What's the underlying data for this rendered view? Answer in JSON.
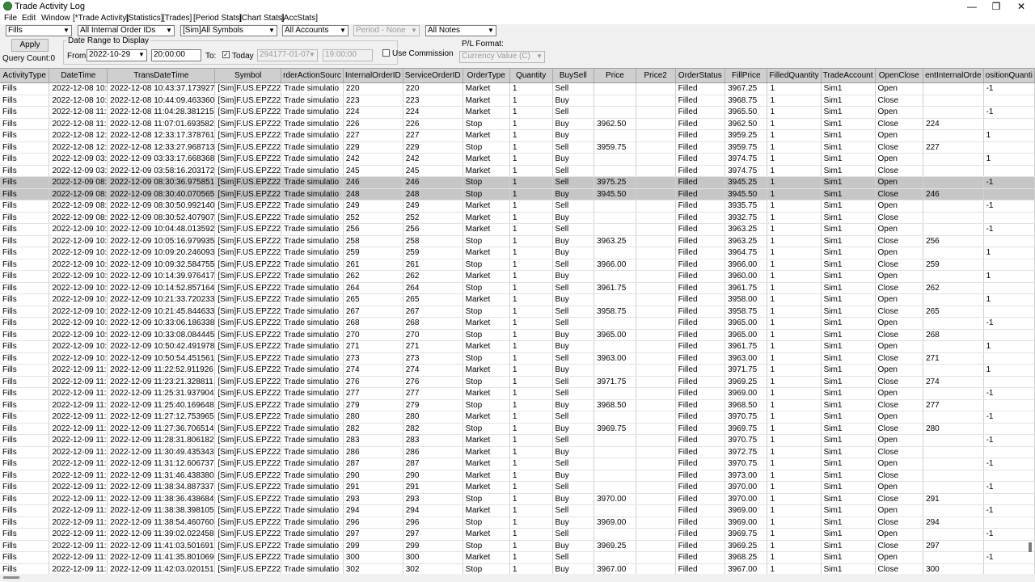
{
  "window": {
    "title": "Trade Activity Log",
    "minimize": "—",
    "maximize": "❐",
    "close": "✕",
    "accent": "#2e8b3a"
  },
  "menu": [
    "File",
    "Edit",
    "Window",
    "[*Trade Activity]",
    "[Statistics]",
    "[Trades]",
    "[Period Stats]",
    "[Chart Stats]",
    "[AccStats]"
  ],
  "toolbar": {
    "activity_filter": "Fills",
    "order_ids": "All Internal Order IDs",
    "symbols": "[Sim]All Symbols",
    "accounts": "All Accounts",
    "period": "Period - None",
    "notes": "All Notes",
    "apply": "Apply",
    "query_count": "Query Count:0",
    "date_range_label": "Date Range to Display",
    "from_label": "From:",
    "from_date": "2022-10-29",
    "from_time": "20:00:00",
    "to_label": "To:",
    "today_label": "Today",
    "to_date": "294177-01-07",
    "to_time": "19:00:00",
    "use_commission": "Use Commission",
    "pl_format_label": "P/L Format:",
    "pl_format": "Currency Value (C)",
    "check": "✓",
    "dropdown": "▼"
  },
  "table": {
    "columns": [
      "ActivityType",
      "DateTime",
      "TransDateTime",
      "Symbol",
      "OrderActionSource",
      "InternalOrderID",
      "ServiceOrderID",
      "OrderType",
      "Quantity",
      "BuySell",
      "Price",
      "Price2",
      "OrderStatus",
      "FillPrice",
      "FilledQuantity",
      "TradeAccount",
      "OpenClose",
      "ParentInternalOrderID",
      "PositionQuantity"
    ],
    "column_display": [
      "ActivityType",
      "DateTime",
      "TransDateTime",
      "Symbol",
      "rderActionSourc",
      "InternalOrderID",
      "ServiceOrderID",
      "OrderType",
      "Quantity",
      "BuySell",
      "Price",
      "Price2",
      "OrderStatus",
      "FillPrice",
      "FilledQuantity",
      "TradeAccount",
      "OpenClose",
      "entInternalOrde",
      "ositionQuanti"
    ],
    "rows": [
      [
        "Fills",
        "2022-12-08 10:",
        "2022-12-08 10:43:37.173927",
        "[Sim]F.US.EPZ22",
        "Trade simulatio",
        "220",
        "220",
        "Market",
        "1",
        "Sell",
        "",
        "",
        "Filled",
        "3967.25",
        "1",
        "Sim1",
        "Open",
        "",
        "-1"
      ],
      [
        "Fills",
        "2022-12-08 10:",
        "2022-12-08 10:44:09.463360",
        "[Sim]F.US.EPZ22",
        "Trade simulatio",
        "223",
        "223",
        "Market",
        "1",
        "Buy",
        "",
        "",
        "Filled",
        "3968.75",
        "1",
        "Sim1",
        "Close",
        "",
        ""
      ],
      [
        "Fills",
        "2022-12-08 11:",
        "2022-12-08 11:04:28.381215",
        "[Sim]F.US.EPZ22",
        "Trade simulatio",
        "224",
        "224",
        "Market",
        "1",
        "Sell",
        "",
        "",
        "Filled",
        "3965.50",
        "1",
        "Sim1",
        "Open",
        "",
        "-1"
      ],
      [
        "Fills",
        "2022-12-08 11:",
        "2022-12-08 11:07:01.693582",
        "[Sim]F.US.EPZ22",
        "Trade simulatio",
        "226",
        "226",
        "Stop",
        "1",
        "Buy",
        "3962.50",
        "",
        "Filled",
        "3962.50",
        "1",
        "Sim1",
        "Close",
        "224",
        ""
      ],
      [
        "Fills",
        "2022-12-08 12:",
        "2022-12-08 12:33:17.378761",
        "[Sim]F.US.EPZ22",
        "Trade simulatio",
        "227",
        "227",
        "Market",
        "1",
        "Buy",
        "",
        "",
        "Filled",
        "3959.25",
        "1",
        "Sim1",
        "Open",
        "",
        "1"
      ],
      [
        "Fills",
        "2022-12-08 12:",
        "2022-12-08 12:33:27.968713",
        "[Sim]F.US.EPZ22",
        "Trade simulatio",
        "229",
        "229",
        "Stop",
        "1",
        "Sell",
        "3959.75",
        "",
        "Filled",
        "3959.75",
        "1",
        "Sim1",
        "Close",
        "227",
        ""
      ],
      [
        "Fills",
        "2022-12-09 03:",
        "2022-12-09 03:33:17.668368",
        "[Sim]F.US.EPZ22",
        "Trade simulatio",
        "242",
        "242",
        "Market",
        "1",
        "Buy",
        "",
        "",
        "Filled",
        "3974.75",
        "1",
        "Sim1",
        "Open",
        "",
        "1"
      ],
      [
        "Fills",
        "2022-12-09 03:",
        "2022-12-09 03:58:16.203172",
        "[Sim]F.US.EPZ22",
        "Trade simulatio",
        "245",
        "245",
        "Market",
        "1",
        "Sell",
        "",
        "",
        "Filled",
        "3974.75",
        "1",
        "Sim1",
        "Close",
        "",
        ""
      ],
      [
        "Fills",
        "2022-12-09 08:",
        "2022-12-09 08:30:36.975851",
        "[Sim]F.US.EPZ22",
        "Trade simulatio",
        "246",
        "246",
        "Stop",
        "1",
        "Sell",
        "3975.25",
        "",
        "Filled",
        "3945.25",
        "1",
        "Sim1",
        "Open",
        "",
        "-1"
      ],
      [
        "Fills",
        "2022-12-09 08:",
        "2022-12-09 08:30:40.070565",
        "[Sim]F.US.EPZ22",
        "Trade simulatio",
        "248",
        "248",
        "Stop",
        "1",
        "Buy",
        "3945.50",
        "",
        "Filled",
        "3945.50",
        "1",
        "Sim1",
        "Close",
        "246",
        ""
      ],
      [
        "Fills",
        "2022-12-09 08:",
        "2022-12-09 08:30:50.992140",
        "[Sim]F.US.EPZ22",
        "Trade simulatio",
        "249",
        "249",
        "Market",
        "1",
        "Sell",
        "",
        "",
        "Filled",
        "3935.75",
        "1",
        "Sim1",
        "Open",
        "",
        "-1"
      ],
      [
        "Fills",
        "2022-12-09 08:",
        "2022-12-09 08:30:52.407907",
        "[Sim]F.US.EPZ22",
        "Trade simulatio",
        "252",
        "252",
        "Market",
        "1",
        "Buy",
        "",
        "",
        "Filled",
        "3932.75",
        "1",
        "Sim1",
        "Close",
        "",
        ""
      ],
      [
        "Fills",
        "2022-12-09 10:",
        "2022-12-09 10:04:48.013592",
        "[Sim]F.US.EPZ22",
        "Trade simulatio",
        "256",
        "256",
        "Market",
        "1",
        "Sell",
        "",
        "",
        "Filled",
        "3963.25",
        "1",
        "Sim1",
        "Open",
        "",
        "-1"
      ],
      [
        "Fills",
        "2022-12-09 10:",
        "2022-12-09 10:05:16.979935",
        "[Sim]F.US.EPZ22",
        "Trade simulatio",
        "258",
        "258",
        "Stop",
        "1",
        "Buy",
        "3963.25",
        "",
        "Filled",
        "3963.25",
        "1",
        "Sim1",
        "Close",
        "256",
        ""
      ],
      [
        "Fills",
        "2022-12-09 10:",
        "2022-12-09 10:09:20.246093",
        "[Sim]F.US.EPZ22",
        "Trade simulatio",
        "259",
        "259",
        "Market",
        "1",
        "Buy",
        "",
        "",
        "Filled",
        "3964.75",
        "1",
        "Sim1",
        "Open",
        "",
        "1"
      ],
      [
        "Fills",
        "2022-12-09 10:",
        "2022-12-09 10:09:32.584755",
        "[Sim]F.US.EPZ22",
        "Trade simulatio",
        "261",
        "261",
        "Stop",
        "1",
        "Sell",
        "3966.00",
        "",
        "Filled",
        "3966.00",
        "1",
        "Sim1",
        "Close",
        "259",
        ""
      ],
      [
        "Fills",
        "2022-12-09 10:",
        "2022-12-09 10:14:39.976417",
        "[Sim]F.US.EPZ22",
        "Trade simulatio",
        "262",
        "262",
        "Market",
        "1",
        "Buy",
        "",
        "",
        "Filled",
        "3960.00",
        "1",
        "Sim1",
        "Open",
        "",
        "1"
      ],
      [
        "Fills",
        "2022-12-09 10:",
        "2022-12-09 10:14:52.857164",
        "[Sim]F.US.EPZ22",
        "Trade simulatio",
        "264",
        "264",
        "Stop",
        "1",
        "Sell",
        "3961.75",
        "",
        "Filled",
        "3961.75",
        "1",
        "Sim1",
        "Close",
        "262",
        ""
      ],
      [
        "Fills",
        "2022-12-09 10:",
        "2022-12-09 10:21:33.720233",
        "[Sim]F.US.EPZ22",
        "Trade simulatio",
        "265",
        "265",
        "Market",
        "1",
        "Buy",
        "",
        "",
        "Filled",
        "3958.00",
        "1",
        "Sim1",
        "Open",
        "",
        "1"
      ],
      [
        "Fills",
        "2022-12-09 10:",
        "2022-12-09 10:21:45.844633",
        "[Sim]F.US.EPZ22",
        "Trade simulatio",
        "267",
        "267",
        "Stop",
        "1",
        "Sell",
        "3958.75",
        "",
        "Filled",
        "3958.75",
        "1",
        "Sim1",
        "Close",
        "265",
        ""
      ],
      [
        "Fills",
        "2022-12-09 10:",
        "2022-12-09 10:33:06.186338",
        "[Sim]F.US.EPZ22",
        "Trade simulatio",
        "268",
        "268",
        "Market",
        "1",
        "Sell",
        "",
        "",
        "Filled",
        "3965.00",
        "1",
        "Sim1",
        "Open",
        "",
        "-1"
      ],
      [
        "Fills",
        "2022-12-09 10:",
        "2022-12-09 10:33:08.084445",
        "[Sim]F.US.EPZ22",
        "Trade simulatio",
        "270",
        "270",
        "Stop",
        "1",
        "Buy",
        "3965.00",
        "",
        "Filled",
        "3965.00",
        "1",
        "Sim1",
        "Close",
        "268",
        ""
      ],
      [
        "Fills",
        "2022-12-09 10:",
        "2022-12-09 10:50:42.491978",
        "[Sim]F.US.EPZ22",
        "Trade simulatio",
        "271",
        "271",
        "Market",
        "1",
        "Buy",
        "",
        "",
        "Filled",
        "3961.75",
        "1",
        "Sim1",
        "Open",
        "",
        "1"
      ],
      [
        "Fills",
        "2022-12-09 10:",
        "2022-12-09 10:50:54.451561",
        "[Sim]F.US.EPZ22",
        "Trade simulatio",
        "273",
        "273",
        "Stop",
        "1",
        "Sell",
        "3963.00",
        "",
        "Filled",
        "3963.00",
        "1",
        "Sim1",
        "Close",
        "271",
        ""
      ],
      [
        "Fills",
        "2022-12-09 11:",
        "2022-12-09 11:22:52.911926",
        "[Sim]F.US.EPZ22",
        "Trade simulatio",
        "274",
        "274",
        "Market",
        "1",
        "Buy",
        "",
        "",
        "Filled",
        "3971.75",
        "1",
        "Sim1",
        "Open",
        "",
        "1"
      ],
      [
        "Fills",
        "2022-12-09 11:",
        "2022-12-09 11:23:21.328811",
        "[Sim]F.US.EPZ22",
        "Trade simulatio",
        "276",
        "276",
        "Stop",
        "1",
        "Sell",
        "3971.75",
        "",
        "Filled",
        "3969.25",
        "1",
        "Sim1",
        "Close",
        "274",
        ""
      ],
      [
        "Fills",
        "2022-12-09 11:",
        "2022-12-09 11:25:31.937904",
        "[Sim]F.US.EPZ22",
        "Trade simulatio",
        "277",
        "277",
        "Market",
        "1",
        "Sell",
        "",
        "",
        "Filled",
        "3969.00",
        "1",
        "Sim1",
        "Open",
        "",
        "-1"
      ],
      [
        "Fills",
        "2022-12-09 11:",
        "2022-12-09 11:25:40.169648",
        "[Sim]F.US.EPZ22",
        "Trade simulatio",
        "279",
        "279",
        "Stop",
        "1",
        "Buy",
        "3968.50",
        "",
        "Filled",
        "3968.50",
        "1",
        "Sim1",
        "Close",
        "277",
        ""
      ],
      [
        "Fills",
        "2022-12-09 11:",
        "2022-12-09 11:27:12.753965",
        "[Sim]F.US.EPZ22",
        "Trade simulatio",
        "280",
        "280",
        "Market",
        "1",
        "Sell",
        "",
        "",
        "Filled",
        "3970.75",
        "1",
        "Sim1",
        "Open",
        "",
        "-1"
      ],
      [
        "Fills",
        "2022-12-09 11:",
        "2022-12-09 11:27:36.706514",
        "[Sim]F.US.EPZ22",
        "Trade simulatio",
        "282",
        "282",
        "Stop",
        "1",
        "Buy",
        "3969.75",
        "",
        "Filled",
        "3969.75",
        "1",
        "Sim1",
        "Close",
        "280",
        ""
      ],
      [
        "Fills",
        "2022-12-09 11:",
        "2022-12-09 11:28:31.806182",
        "[Sim]F.US.EPZ22",
        "Trade simulatio",
        "283",
        "283",
        "Market",
        "1",
        "Sell",
        "",
        "",
        "Filled",
        "3970.75",
        "1",
        "Sim1",
        "Open",
        "",
        "-1"
      ],
      [
        "Fills",
        "2022-12-09 11:",
        "2022-12-09 11:30:49.435343",
        "[Sim]F.US.EPZ22",
        "Trade simulatio",
        "286",
        "286",
        "Market",
        "1",
        "Buy",
        "",
        "",
        "Filled",
        "3972.75",
        "1",
        "Sim1",
        "Close",
        "",
        ""
      ],
      [
        "Fills",
        "2022-12-09 11:",
        "2022-12-09 11:31:12.606737",
        "[Sim]F.US.EPZ22",
        "Trade simulatio",
        "287",
        "287",
        "Market",
        "1",
        "Sell",
        "",
        "",
        "Filled",
        "3970.75",
        "1",
        "Sim1",
        "Open",
        "",
        "-1"
      ],
      [
        "Fills",
        "2022-12-09 11:",
        "2022-12-09 11:31:46.438380",
        "[Sim]F.US.EPZ22",
        "Trade simulatio",
        "290",
        "290",
        "Market",
        "1",
        "Buy",
        "",
        "",
        "Filled",
        "3973.00",
        "1",
        "Sim1",
        "Close",
        "",
        ""
      ],
      [
        "Fills",
        "2022-12-09 11:",
        "2022-12-09 11:38:34.887337",
        "[Sim]F.US.EPZ22",
        "Trade simulatio",
        "291",
        "291",
        "Market",
        "1",
        "Sell",
        "",
        "",
        "Filled",
        "3970.00",
        "1",
        "Sim1",
        "Open",
        "",
        "-1"
      ],
      [
        "Fills",
        "2022-12-09 11:",
        "2022-12-09 11:38:36.438684",
        "[Sim]F.US.EPZ22",
        "Trade simulatio",
        "293",
        "293",
        "Stop",
        "1",
        "Buy",
        "3970.00",
        "",
        "Filled",
        "3970.00",
        "1",
        "Sim1",
        "Close",
        "291",
        ""
      ],
      [
        "Fills",
        "2022-12-09 11:",
        "2022-12-09 11:38:38.398105",
        "[Sim]F.US.EPZ22",
        "Trade simulatio",
        "294",
        "294",
        "Market",
        "1",
        "Sell",
        "",
        "",
        "Filled",
        "3969.00",
        "1",
        "Sim1",
        "Open",
        "",
        "-1"
      ],
      [
        "Fills",
        "2022-12-09 11:",
        "2022-12-09 11:38:54.460760",
        "[Sim]F.US.EPZ22",
        "Trade simulatio",
        "296",
        "296",
        "Stop",
        "1",
        "Buy",
        "3969.00",
        "",
        "Filled",
        "3969.00",
        "1",
        "Sim1",
        "Close",
        "294",
        ""
      ],
      [
        "Fills",
        "2022-12-09 11:",
        "2022-12-09 11:39:02.022458",
        "[Sim]F.US.EPZ22",
        "Trade simulatio",
        "297",
        "297",
        "Market",
        "1",
        "Sell",
        "",
        "",
        "Filled",
        "3969.75",
        "1",
        "Sim1",
        "Open",
        "",
        "-1"
      ],
      [
        "Fills",
        "2022-12-09 11:",
        "2022-12-09 11:41:03.501691",
        "[Sim]F.US.EPZ22",
        "Trade simulatio",
        "299",
        "299",
        "Stop",
        "1",
        "Buy",
        "3969.25",
        "",
        "Filled",
        "3969.25",
        "1",
        "Sim1",
        "Close",
        "297",
        ""
      ],
      [
        "Fills",
        "2022-12-09 11:",
        "2022-12-09 11:41:35.801069",
        "[Sim]F.US.EPZ22",
        "Trade simulatio",
        "300",
        "300",
        "Market",
        "1",
        "Sell",
        "",
        "",
        "Filled",
        "3968.25",
        "1",
        "Sim1",
        "Open",
        "",
        "-1"
      ],
      [
        "Fills",
        "2022-12-09 11:",
        "2022-12-09 11:42:03.020151",
        "[Sim]F.US.EPZ22",
        "Trade simulatio",
        "302",
        "302",
        "Stop",
        "1",
        "Buy",
        "3967.00",
        "",
        "Filled",
        "3967.00",
        "1",
        "Sim1",
        "Close",
        "300",
        ""
      ]
    ],
    "selected_rows": [
      8,
      9
    ]
  }
}
